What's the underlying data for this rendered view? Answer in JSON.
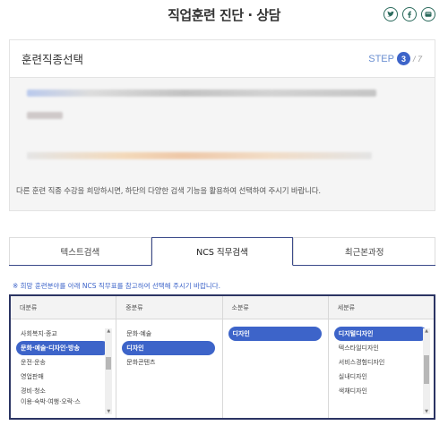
{
  "page": {
    "title": "직업훈련 진단 · 상담"
  },
  "share": {
    "icons": [
      "twitter-icon",
      "facebook-icon",
      "kakao-icon"
    ]
  },
  "step": {
    "title": "훈련직종선택",
    "step_label": "STEP",
    "current": "3",
    "total": "/ 7",
    "description": "다른 훈련 직종 수강을 희망하시면, 하단의 다양한 검색 기능을 활용하여 선택하여 주시기 바랍니다."
  },
  "tabs": [
    {
      "label": "텍스트검색",
      "active": false
    },
    {
      "label": "NCS 직무검색",
      "active": true
    },
    {
      "label": "최근본과정",
      "active": false
    }
  ],
  "notice": "※ 희망 훈련분야를 아래 NCS 직무표를 참고하여 선택해 주시기 바랍니다.",
  "ncs": {
    "columns": [
      {
        "header": "대분류",
        "items": [
          "사회복지·종교",
          "문화·예술·디자인·방송",
          "운전·운송",
          "영업판매",
          "경비·청소",
          "이용·숙박·여행·오락·스"
        ],
        "selected": 1
      },
      {
        "header": "중분류",
        "items": [
          "문화·예술",
          "디자인",
          "문화콘텐츠"
        ],
        "selected": 1
      },
      {
        "header": "소분류",
        "items": [
          "디자인"
        ],
        "selected": 0
      },
      {
        "header": "세분류",
        "items": [
          "디지털디자인",
          "텍스타일디자인",
          "서비스경험디자인",
          "실내디자인",
          "색채디자인"
        ],
        "selected": 0
      }
    ]
  },
  "colors": {
    "accent": "#3d64c9",
    "frame": "#2b3463",
    "share_icon": "#2b6a5c"
  }
}
